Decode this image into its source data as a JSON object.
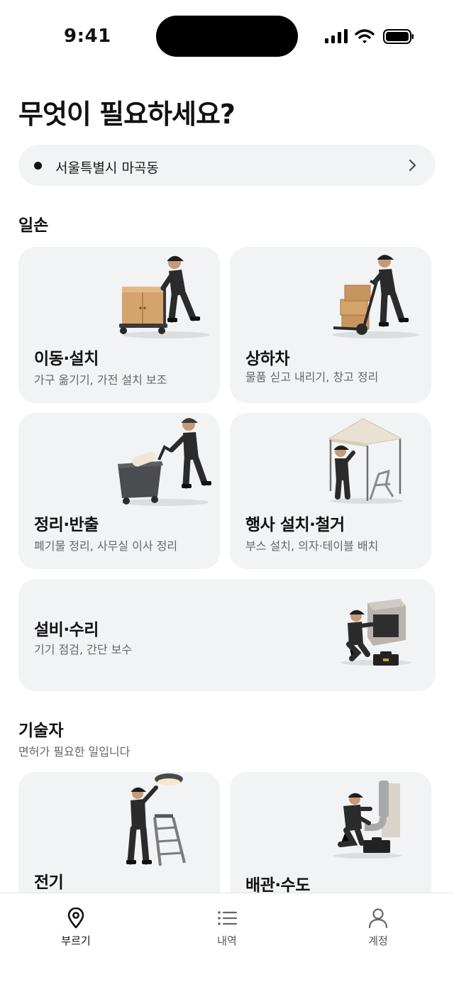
{
  "status_bar": {
    "time": "9:41"
  },
  "header": {
    "title": "무엇이 필요하세요?"
  },
  "location": {
    "text": "서울특별시 마곡동"
  },
  "sections": {
    "labor": {
      "title": "일손",
      "cards": [
        {
          "title": "이동·설치",
          "desc": "가구 옮기기, 가전 설치 보조",
          "icon": "worker-pushing-cabinet-icon"
        },
        {
          "title": "상하차",
          "desc": "물품 싣고 내리기, 창고 정리",
          "icon": "worker-hand-truck-boxes-icon"
        },
        {
          "title": "정리·반출",
          "desc": "폐기물 정리, 사무실 이사 정리",
          "icon": "worker-pushing-cart-icon"
        },
        {
          "title": "행사 설치·철거",
          "desc": "부스 설치, 의자·테이블 배치",
          "icon": "worker-tent-chair-icon"
        },
        {
          "title": "설비·수리",
          "desc": "기기 점검, 간단 보수",
          "icon": "worker-repairing-machine-icon"
        }
      ]
    },
    "technician": {
      "title": "기술자",
      "subtitle": "면허가 필요한 일입니다",
      "cards": [
        {
          "title": "전기",
          "icon": "electrician-ladder-lamp-icon"
        },
        {
          "title": "배관·수도",
          "icon": "plumber-pipe-icon"
        }
      ]
    }
  },
  "tab_bar": {
    "tabs": [
      {
        "label": "부르기",
        "icon": "location-pin-icon",
        "active": true
      },
      {
        "label": "내역",
        "icon": "list-icon",
        "active": false
      },
      {
        "label": "계정",
        "icon": "person-icon",
        "active": false
      }
    ]
  },
  "colors": {
    "card_bg": "#f2f3f5",
    "text": "#111111",
    "muted": "#666666",
    "uniform": "#2b2b2b",
    "box": "#c9955e"
  }
}
